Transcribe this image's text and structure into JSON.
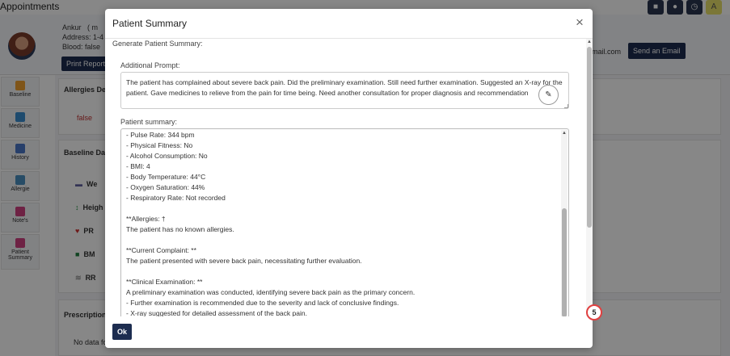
{
  "app": {
    "title": "Appointments",
    "patient": {
      "name": "Ankur",
      "name_suffix": "( m",
      "address": "Address: 1-4",
      "blood": "Blood: false",
      "email_fragment": "mail.com"
    },
    "print_report_label": "Print Report",
    "send_email_label": "Send an Email",
    "sidebar": [
      {
        "label": "Baseline",
        "icon": "clipboard-icon",
        "color": "#f0a030"
      },
      {
        "label": "Medicine",
        "icon": "medicine-icon",
        "color": "#3a8fd0"
      },
      {
        "label": "History",
        "icon": "history-icon",
        "color": "#4a78c8"
      },
      {
        "label": "Allergie",
        "icon": "allergy-icon",
        "color": "#4a90c0"
      },
      {
        "label": "Note's",
        "icon": "notes-icon",
        "color": "#d04080"
      },
      {
        "label": "Patient Summary",
        "icon": "summary-icon",
        "color": "#d04080"
      }
    ],
    "allergies_card": {
      "title": "Allergies De",
      "value": "false"
    },
    "baseline_card": {
      "title": "Baseline Dat",
      "rows": [
        {
          "label": "We",
          "icon": "ruler-icon"
        },
        {
          "label": "Heigh",
          "icon": "height-icon"
        },
        {
          "label": "PR",
          "icon": "heart-icon"
        },
        {
          "label": "BM",
          "icon": "bmi-icon"
        },
        {
          "label": "RR",
          "icon": "lungs-icon"
        }
      ]
    },
    "prescription_card": {
      "title": "Prescription",
      "empty": "No data fo"
    }
  },
  "modal": {
    "title": "Patient Summary",
    "close_label": "×",
    "generate_label": "Generate Patient Summary:",
    "prompt_label": "Additional Prompt:",
    "prompt_text": "The patient has complained about severe back pain. Did the preliminary examination. Still need further examination. Suggested an X-ray for the patient. Gave medicines to relieve from the pain for time being. Need another consultation for proper diagnosis and recommendation",
    "summary_label": "Patient summary:",
    "summary_lines": [
      "- Pulse Rate: 344 bpm",
      "- Physical Fitness: No",
      "- Alcohol Consumption: No",
      "- BMI: 4",
      "- Body Temperature: 44°C",
      "- Oxygen Saturation: 44%",
      "- Respiratory Rate: Not recorded",
      "",
      "**Allergies: †",
      "The patient has no known allergies.",
      "",
      "**Current Complaint: **",
      "The patient presented with severe back pain, necessitating further evaluation.",
      "",
      "**Clinical Examination: **",
      "A preliminary examination was conducted, identifying severe back pain as the primary concern.",
      "- Further examination is recommended due to the severity and lack of conclusive findings.",
      "- X-ray suggested for detailed assessment of the back pain."
    ],
    "ok_label": "Ok",
    "badge": "5"
  }
}
